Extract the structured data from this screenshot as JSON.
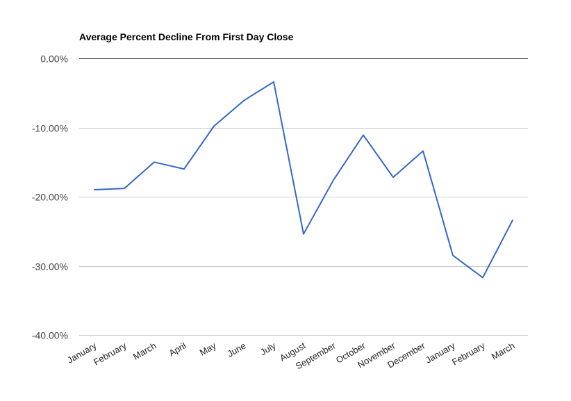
{
  "chart_data": {
    "type": "line",
    "title": "Average Percent Decline From First Day Close",
    "xlabel": "",
    "ylabel": "",
    "categories": [
      "January",
      "February",
      "March",
      "April",
      "May",
      "June",
      "July",
      "August",
      "September",
      "October",
      "November",
      "December",
      "January",
      "February",
      "March"
    ],
    "series": [
      {
        "name": "Average Percent Decline",
        "color": "#3366cc",
        "values": [
          -19.0,
          -18.8,
          -15.0,
          -16.0,
          -9.8,
          -6.1,
          -3.4,
          -25.4,
          -17.6,
          -11.1,
          -17.2,
          -13.4,
          -28.5,
          -31.7,
          -23.4
        ]
      }
    ],
    "ylim": [
      -40,
      0
    ],
    "yticks": [
      0,
      -10,
      -20,
      -30,
      -40
    ],
    "ytick_labels": [
      "0.00%",
      "-10.00%",
      "-20.00%",
      "-30.00%",
      "-40.00%"
    ],
    "grid": true,
    "legend": "none"
  }
}
